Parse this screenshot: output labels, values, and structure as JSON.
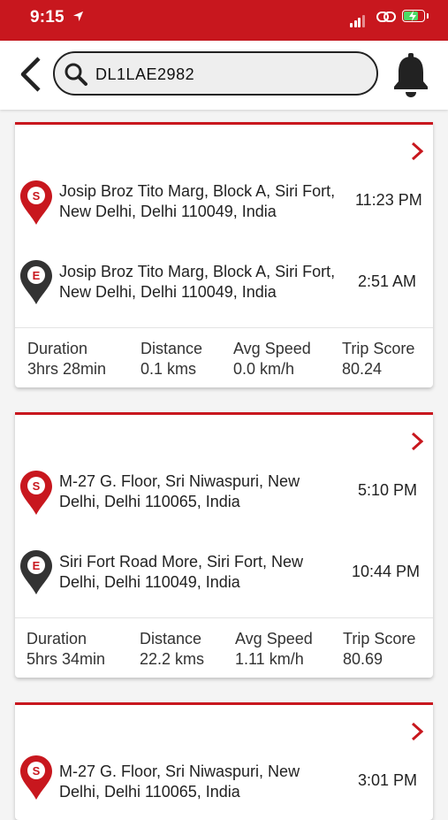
{
  "status_bar": {
    "time": "9:15"
  },
  "search": {
    "value": "DL1LAE2982"
  },
  "colors": {
    "brand": "#c8171e",
    "start_pin": "#c8171e",
    "end_pin": "#333333"
  },
  "trips": [
    {
      "start": {
        "badge": "S",
        "address": "Josip Broz Tito Marg, Block A, Siri Fort, New Delhi, Delhi 110049, India",
        "time": "11:23 PM"
      },
      "end": {
        "badge": "E",
        "address": "Josip Broz Tito Marg, Block A, Siri Fort, New Delhi, Delhi 110049, India",
        "time": "2:51 AM"
      },
      "stats": [
        {
          "label": "Duration",
          "value": "3hrs 28min"
        },
        {
          "label": "Distance",
          "value": "0.1 kms"
        },
        {
          "label": "Avg Speed",
          "value": "0.0 km/h"
        },
        {
          "label": "Trip Score",
          "value": "80.24"
        }
      ]
    },
    {
      "start": {
        "badge": "S",
        "address": "M-27 G. Floor, Sri Niwaspuri, New Delhi, Delhi 110065, India",
        "time": "5:10 PM"
      },
      "end": {
        "badge": "E",
        "address": "Siri Fort Road More, Siri Fort, New Delhi, Delhi 110049, India",
        "time": "10:44 PM"
      },
      "stats": [
        {
          "label": "Duration",
          "value": "5hrs 34min"
        },
        {
          "label": "Distance",
          "value": "22.2 kms"
        },
        {
          "label": "Avg Speed",
          "value": "1.11 km/h"
        },
        {
          "label": "Trip Score",
          "value": "80.69"
        }
      ]
    },
    {
      "start": {
        "badge": "S",
        "address": "M-27 G. Floor, Sri Niwaspuri, New Delhi, Delhi 110065, India",
        "time": "3:01 PM"
      }
    }
  ]
}
